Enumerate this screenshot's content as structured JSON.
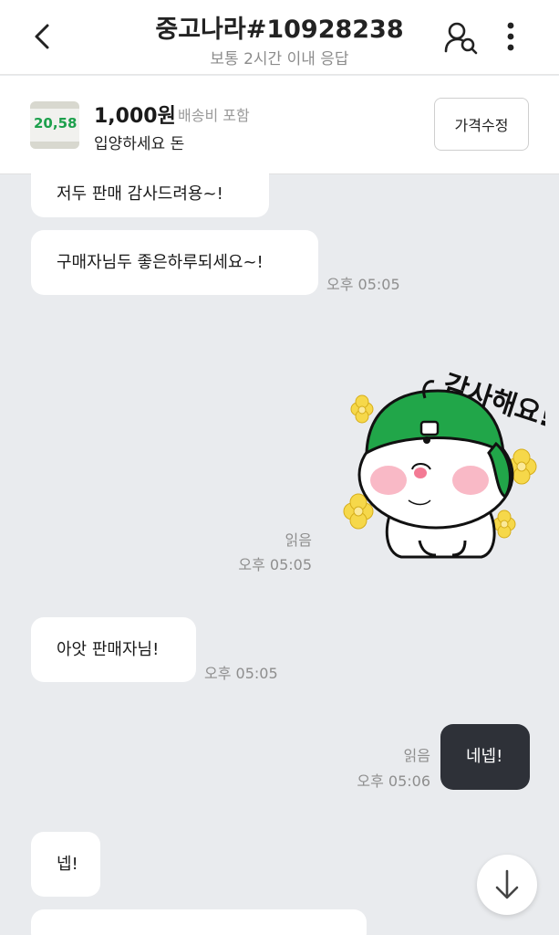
{
  "header": {
    "title": "중고나라#10928238",
    "subtitle": "보통 2시간 이내 응답"
  },
  "product": {
    "thumb_text": "20,58",
    "price": "1,000원",
    "shipping": "배송비 포함",
    "name": "입양하세요 돈",
    "edit_label": "가격수정"
  },
  "messages": [
    {
      "from": "other",
      "text": "저두 판매 감사드려용~!"
    },
    {
      "from": "other",
      "text": "구매자님두 좋은하루되세요~!",
      "time": "오후 05:05"
    },
    {
      "from": "me",
      "type": "sticker",
      "sticker_text": "감사해요!",
      "read": "읽음",
      "time": "오후 05:05"
    },
    {
      "from": "other",
      "text": "아앗 판매자님!",
      "time": "오후 05:05"
    },
    {
      "from": "me",
      "text": "네넵!",
      "read": "읽음",
      "time": "오후 05:06"
    },
    {
      "from": "other",
      "text": "넵!"
    }
  ],
  "colors": {
    "accent_green": "#21a649",
    "outgoing_bubble": "#2e3138",
    "chat_background": "#e9ebee"
  }
}
